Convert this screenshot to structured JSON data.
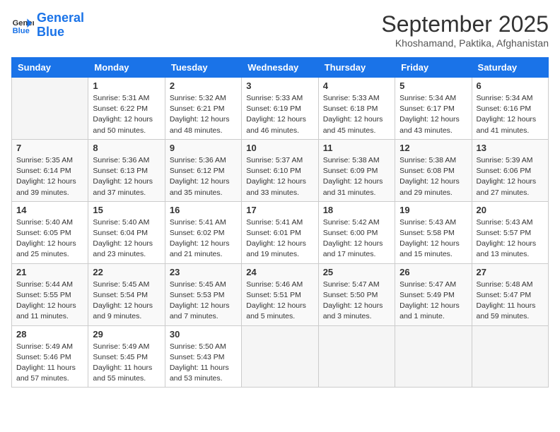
{
  "header": {
    "logo_line1": "General",
    "logo_line2": "Blue",
    "month": "September 2025",
    "location": "Khoshamand, Paktika, Afghanistan"
  },
  "days_of_week": [
    "Sunday",
    "Monday",
    "Tuesday",
    "Wednesday",
    "Thursday",
    "Friday",
    "Saturday"
  ],
  "weeks": [
    [
      {
        "day": "",
        "info": ""
      },
      {
        "day": "1",
        "info": "Sunrise: 5:31 AM\nSunset: 6:22 PM\nDaylight: 12 hours\nand 50 minutes."
      },
      {
        "day": "2",
        "info": "Sunrise: 5:32 AM\nSunset: 6:21 PM\nDaylight: 12 hours\nand 48 minutes."
      },
      {
        "day": "3",
        "info": "Sunrise: 5:33 AM\nSunset: 6:19 PM\nDaylight: 12 hours\nand 46 minutes."
      },
      {
        "day": "4",
        "info": "Sunrise: 5:33 AM\nSunset: 6:18 PM\nDaylight: 12 hours\nand 45 minutes."
      },
      {
        "day": "5",
        "info": "Sunrise: 5:34 AM\nSunset: 6:17 PM\nDaylight: 12 hours\nand 43 minutes."
      },
      {
        "day": "6",
        "info": "Sunrise: 5:34 AM\nSunset: 6:16 PM\nDaylight: 12 hours\nand 41 minutes."
      }
    ],
    [
      {
        "day": "7",
        "info": "Sunrise: 5:35 AM\nSunset: 6:14 PM\nDaylight: 12 hours\nand 39 minutes."
      },
      {
        "day": "8",
        "info": "Sunrise: 5:36 AM\nSunset: 6:13 PM\nDaylight: 12 hours\nand 37 minutes."
      },
      {
        "day": "9",
        "info": "Sunrise: 5:36 AM\nSunset: 6:12 PM\nDaylight: 12 hours\nand 35 minutes."
      },
      {
        "day": "10",
        "info": "Sunrise: 5:37 AM\nSunset: 6:10 PM\nDaylight: 12 hours\nand 33 minutes."
      },
      {
        "day": "11",
        "info": "Sunrise: 5:38 AM\nSunset: 6:09 PM\nDaylight: 12 hours\nand 31 minutes."
      },
      {
        "day": "12",
        "info": "Sunrise: 5:38 AM\nSunset: 6:08 PM\nDaylight: 12 hours\nand 29 minutes."
      },
      {
        "day": "13",
        "info": "Sunrise: 5:39 AM\nSunset: 6:06 PM\nDaylight: 12 hours\nand 27 minutes."
      }
    ],
    [
      {
        "day": "14",
        "info": "Sunrise: 5:40 AM\nSunset: 6:05 PM\nDaylight: 12 hours\nand 25 minutes."
      },
      {
        "day": "15",
        "info": "Sunrise: 5:40 AM\nSunset: 6:04 PM\nDaylight: 12 hours\nand 23 minutes."
      },
      {
        "day": "16",
        "info": "Sunrise: 5:41 AM\nSunset: 6:02 PM\nDaylight: 12 hours\nand 21 minutes."
      },
      {
        "day": "17",
        "info": "Sunrise: 5:41 AM\nSunset: 6:01 PM\nDaylight: 12 hours\nand 19 minutes."
      },
      {
        "day": "18",
        "info": "Sunrise: 5:42 AM\nSunset: 6:00 PM\nDaylight: 12 hours\nand 17 minutes."
      },
      {
        "day": "19",
        "info": "Sunrise: 5:43 AM\nSunset: 5:58 PM\nDaylight: 12 hours\nand 15 minutes."
      },
      {
        "day": "20",
        "info": "Sunrise: 5:43 AM\nSunset: 5:57 PM\nDaylight: 12 hours\nand 13 minutes."
      }
    ],
    [
      {
        "day": "21",
        "info": "Sunrise: 5:44 AM\nSunset: 5:55 PM\nDaylight: 12 hours\nand 11 minutes."
      },
      {
        "day": "22",
        "info": "Sunrise: 5:45 AM\nSunset: 5:54 PM\nDaylight: 12 hours\nand 9 minutes."
      },
      {
        "day": "23",
        "info": "Sunrise: 5:45 AM\nSunset: 5:53 PM\nDaylight: 12 hours\nand 7 minutes."
      },
      {
        "day": "24",
        "info": "Sunrise: 5:46 AM\nSunset: 5:51 PM\nDaylight: 12 hours\nand 5 minutes."
      },
      {
        "day": "25",
        "info": "Sunrise: 5:47 AM\nSunset: 5:50 PM\nDaylight: 12 hours\nand 3 minutes."
      },
      {
        "day": "26",
        "info": "Sunrise: 5:47 AM\nSunset: 5:49 PM\nDaylight: 12 hours\nand 1 minute."
      },
      {
        "day": "27",
        "info": "Sunrise: 5:48 AM\nSunset: 5:47 PM\nDaylight: 11 hours\nand 59 minutes."
      }
    ],
    [
      {
        "day": "28",
        "info": "Sunrise: 5:49 AM\nSunset: 5:46 PM\nDaylight: 11 hours\nand 57 minutes."
      },
      {
        "day": "29",
        "info": "Sunrise: 5:49 AM\nSunset: 5:45 PM\nDaylight: 11 hours\nand 55 minutes."
      },
      {
        "day": "30",
        "info": "Sunrise: 5:50 AM\nSunset: 5:43 PM\nDaylight: 11 hours\nand 53 minutes."
      },
      {
        "day": "",
        "info": ""
      },
      {
        "day": "",
        "info": ""
      },
      {
        "day": "",
        "info": ""
      },
      {
        "day": "",
        "info": ""
      }
    ]
  ]
}
